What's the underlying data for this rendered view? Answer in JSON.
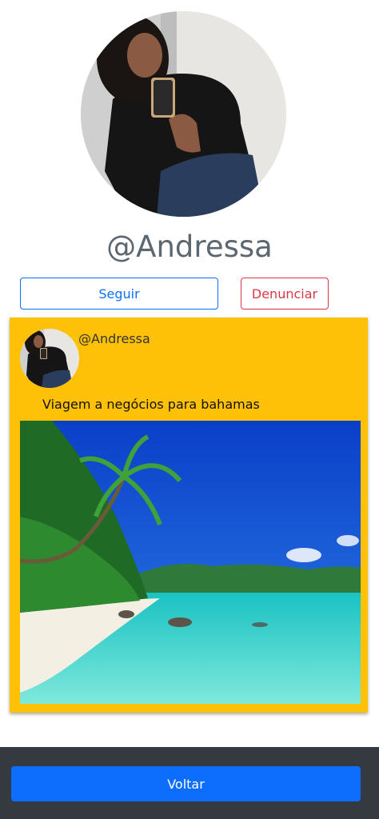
{
  "profile": {
    "username": "@Andressa",
    "avatar_icon": "profile-photo"
  },
  "actions": {
    "follow_label": "Seguir",
    "report_label": "Denunciar"
  },
  "post": {
    "author": "@Andressa",
    "caption": "Viagem a negócios para bahamas",
    "image_icon": "beach-photo"
  },
  "footer": {
    "back_label": "Voltar"
  },
  "colors": {
    "card": "#ffc107",
    "primary": "#0d6efd",
    "danger": "#dc3545",
    "footer": "#343a40"
  }
}
